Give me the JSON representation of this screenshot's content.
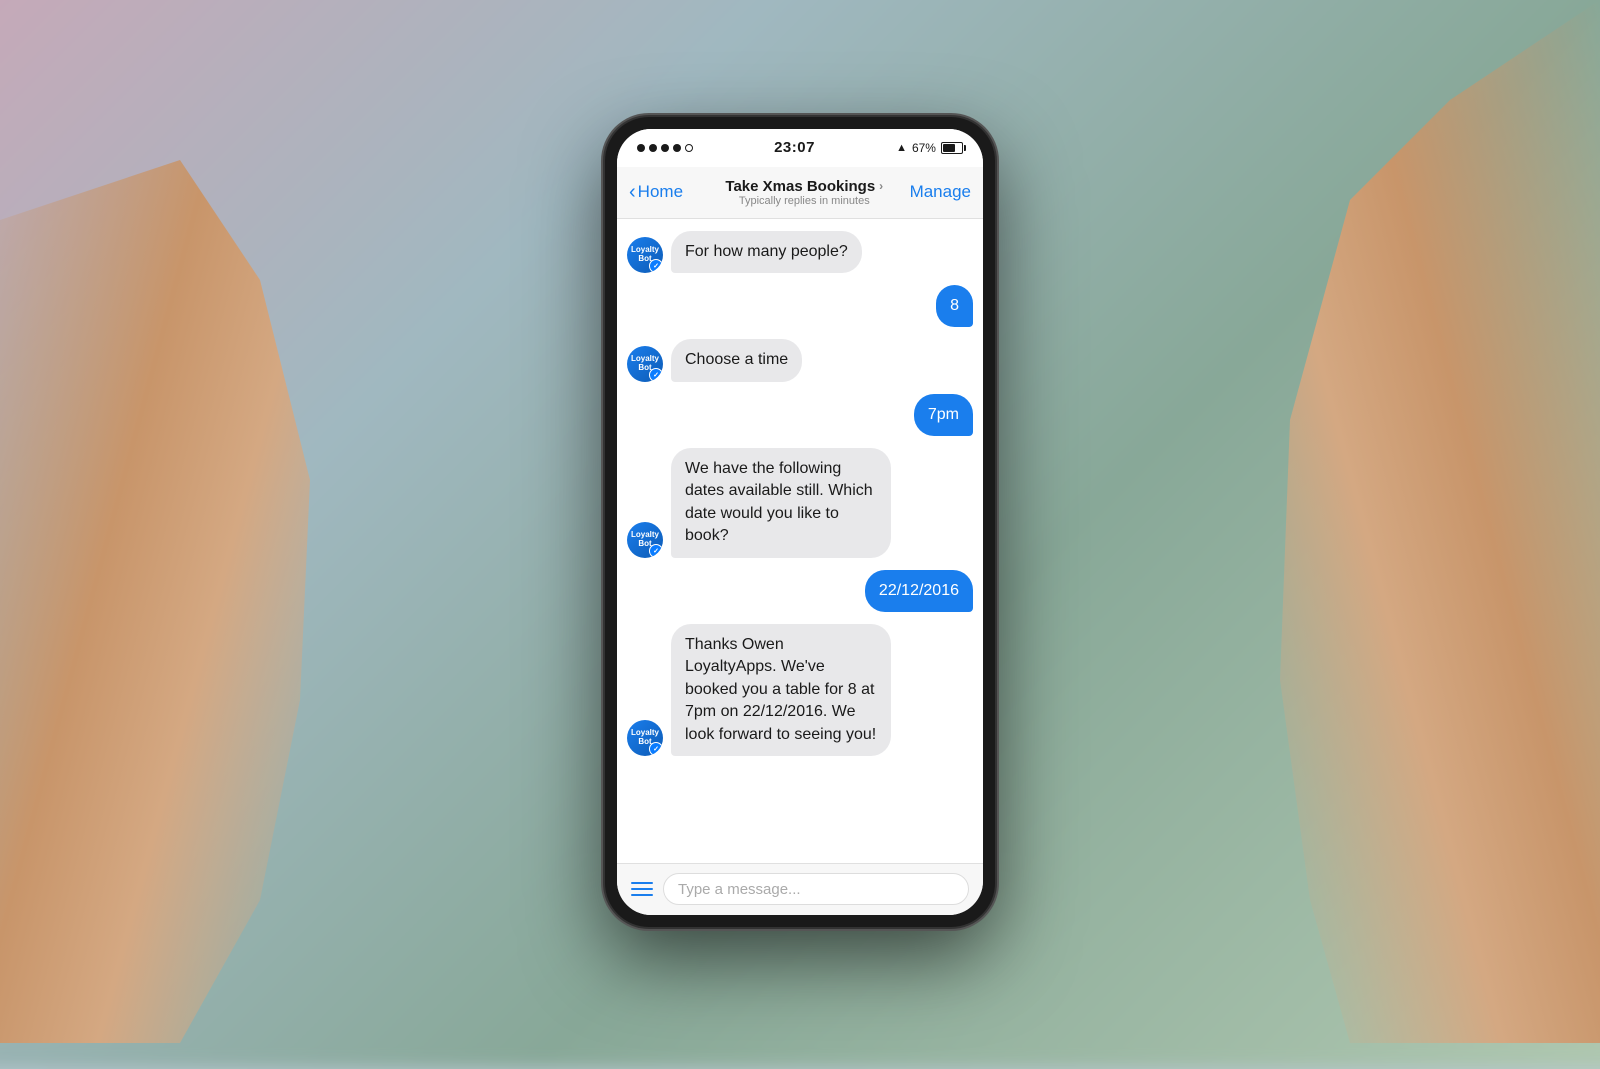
{
  "background": {
    "color": "#b0bec5"
  },
  "status_bar": {
    "signal_dots": 4,
    "time": "23:07",
    "location_icon": "▲",
    "battery_percent": "67%",
    "wifi_icon": "wifi"
  },
  "nav": {
    "back_label": "Home",
    "title": "Take Xmas Bookings",
    "title_chevron": "›",
    "subtitle": "Typically replies in minutes",
    "manage_label": "Manage"
  },
  "messages": [
    {
      "type": "bot",
      "text": "For how many people?",
      "avatar_line1": "Loyalty",
      "avatar_line2": "Bot"
    },
    {
      "type": "user",
      "text": "8"
    },
    {
      "type": "bot",
      "text": "Choose a time",
      "avatar_line1": "Loyalty",
      "avatar_line2": "Bot"
    },
    {
      "type": "user",
      "text": "7pm"
    },
    {
      "type": "bot",
      "text": "We have the following dates available still. Which date would you like to book?",
      "avatar_line1": "Loyalty",
      "avatar_line2": "Bot"
    },
    {
      "type": "user",
      "text": "22/12/2016"
    },
    {
      "type": "bot",
      "text": "Thanks Owen LoyaltyApps. We've booked you a table for 8 at 7pm on 22/12/2016. We look forward to seeing you!",
      "avatar_line1": "Loyalty",
      "avatar_line2": "Bot"
    }
  ],
  "input_bar": {
    "placeholder": "Type a message...",
    "hamburger_lines": 3
  },
  "colors": {
    "accent": "#1a7eed",
    "user_bubble": "#1a7eed",
    "bot_bubble": "#e8e8ea",
    "nav_text": "#1a7eed"
  }
}
